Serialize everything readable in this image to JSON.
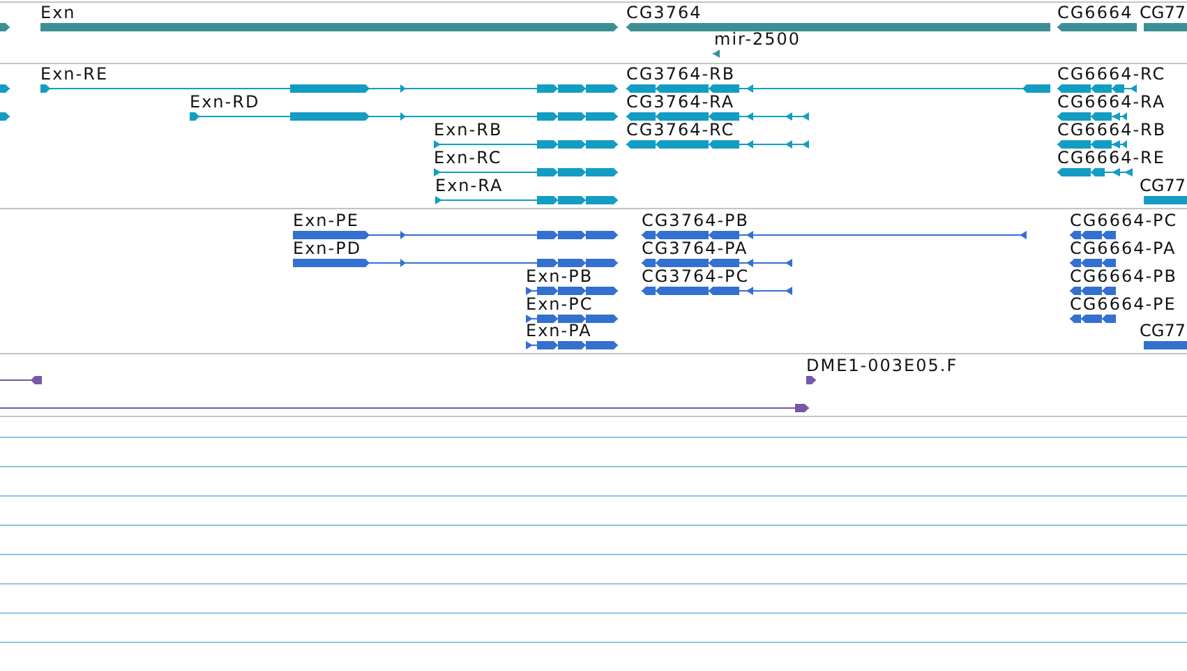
{
  "tracks": [
    {
      "kind": "gene",
      "features": [
        {
          "reverse": false
        },
        {
          "label": "Exn",
          "reverse": false
        },
        {
          "label": "CG3764",
          "reverse": true
        },
        {
          "label": "mir-2500",
          "reverse": true
        },
        {
          "label": "CG6664",
          "reverse": true
        },
        {
          "label": "CG77",
          "reverse": false
        }
      ]
    },
    {
      "kind": "transcript",
      "features": [
        {
          "reverse": false
        },
        {
          "label": "Exn-RE",
          "reverse": false
        },
        {
          "label": "CG3764-RB",
          "reverse": true
        },
        {
          "label": "CG6664-RC",
          "reverse": true
        },
        {
          "reverse": false
        },
        {
          "label": "Exn-RD",
          "reverse": false
        },
        {
          "label": "CG3764-RA",
          "reverse": true
        },
        {
          "label": "CG6664-RA",
          "reverse": true
        },
        {
          "label": "Exn-RB",
          "reverse": false
        },
        {
          "label": "CG3764-RC",
          "reverse": true
        },
        {
          "label": "CG6664-RB",
          "reverse": true
        },
        {
          "label": "Exn-RC",
          "reverse": false
        },
        {
          "label": "CG6664-RE",
          "reverse": true
        },
        {
          "label": "Exn-RA",
          "reverse": false
        },
        {
          "label": "CG77",
          "reverse": false
        }
      ]
    },
    {
      "kind": "protein",
      "features": [
        {
          "label": "Exn-PE",
          "reverse": false
        },
        {
          "label": "CG3764-PB",
          "reverse": true
        },
        {
          "label": "CG6664-PC",
          "reverse": true
        },
        {
          "label": "Exn-PD",
          "reverse": false
        },
        {
          "label": "CG3764-PA",
          "reverse": true
        },
        {
          "label": "CG6664-PA",
          "reverse": true
        },
        {
          "label": "Exn-PB",
          "reverse": false
        },
        {
          "label": "CG3764-PC",
          "reverse": true
        },
        {
          "label": "CG6664-PB",
          "reverse": true
        },
        {
          "label": "Exn-PC",
          "reverse": false
        },
        {
          "label": "CG6664-PE",
          "reverse": true
        },
        {
          "label": "Exn-PA",
          "reverse": false
        },
        {
          "label": "CG77",
          "reverse": false
        }
      ]
    },
    {
      "kind": "clone",
      "features": [
        {
          "reverse": true
        },
        {
          "label": "DME1-003E05.F",
          "reverse": false
        },
        {
          "reverse": false
        }
      ]
    }
  ]
}
